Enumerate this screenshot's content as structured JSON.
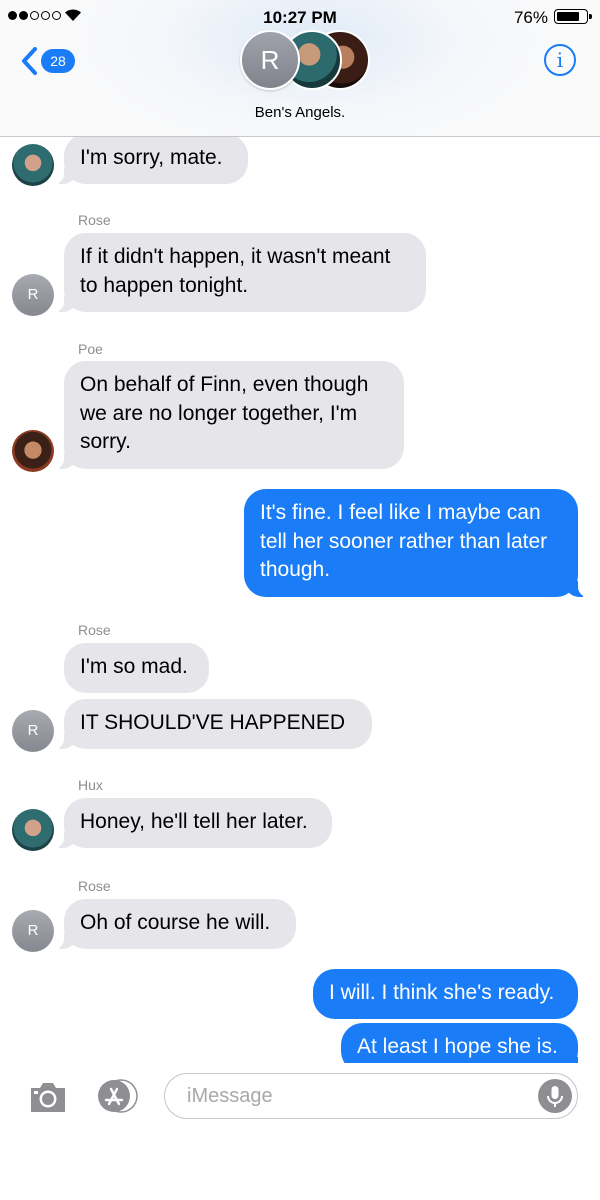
{
  "status": {
    "time": "10:27 PM",
    "battery": "76%"
  },
  "header": {
    "back_badge": "28",
    "avatar_letter": "R",
    "group_name": "Ben's Angels.",
    "info_glyph": "i"
  },
  "messages": [
    {
      "from": "Hux",
      "text": "I'm sorry, mate."
    },
    {
      "from": "Rose",
      "text": "If it didn't happen, it wasn't meant\nto happen tonight."
    },
    {
      "from": "Poe",
      "text": "On behalf of Finn, even though\nwe are no longer together, I'm\nsorry."
    },
    {
      "from": "me",
      "text": "It's fine. I feel like I maybe can\ntell her sooner rather than later\nthough."
    },
    {
      "from": "Rose",
      "text": "I'm so mad."
    },
    {
      "from": "Rose",
      "text": "IT SHOULD'VE HAPPENED"
    },
    {
      "from": "Hux",
      "text": "Honey, he'll tell her later."
    },
    {
      "from": "Rose",
      "text": "Oh of course he will."
    },
    {
      "from": "me",
      "text": "I will. I think she's ready."
    },
    {
      "from": "me",
      "text": "At least I hope she is."
    }
  ],
  "senders": {
    "rose": "Rose",
    "poe": "Poe",
    "hux": "Hux"
  },
  "avatar_letter": "R",
  "input": {
    "placeholder": "iMessage"
  },
  "colors": {
    "outgoing": "#1a7cf7",
    "incoming": "#e5e5ea",
    "accent": "#1a7cf7"
  }
}
